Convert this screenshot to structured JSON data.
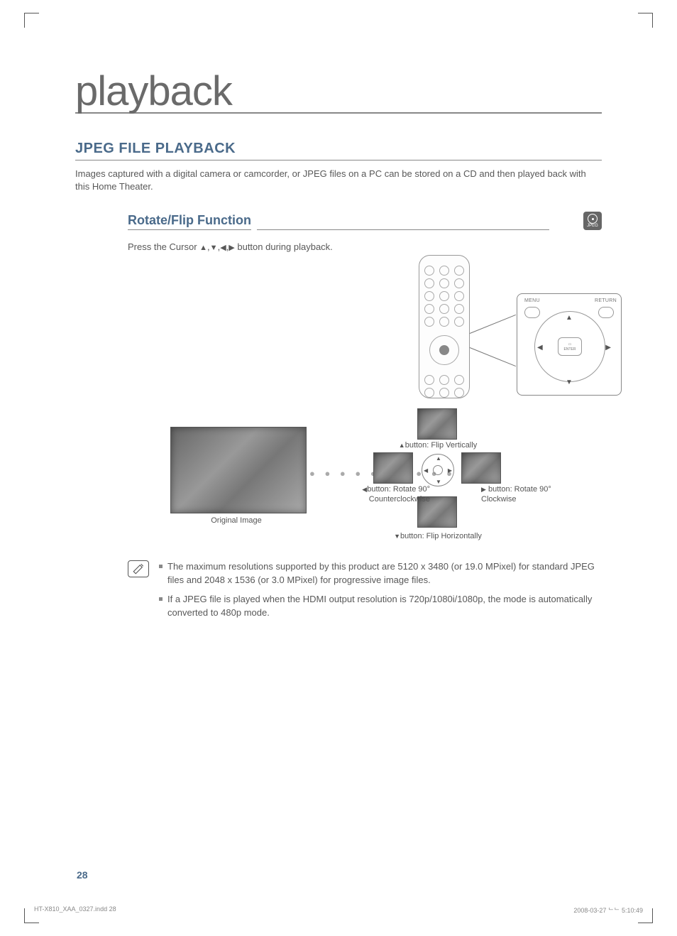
{
  "chapter_title": "playback",
  "section_title": "JPEG FILE PLAYBACK",
  "intro_text": "Images captured with a digital camera or camcorder, or JPEG files on a PC can be stored on a CD and then played back with this Home Theater.",
  "subsection_title": "Rotate/Flip Function",
  "badge_label": "JPEG",
  "instruction_prefix": "Press the Cursor ",
  "instruction_suffix": " button during playback.",
  "remote_close": {
    "menu": "MENU",
    "return": "RETURN",
    "enter": "ENTER"
  },
  "captions": {
    "original": "Original Image",
    "up": "button: Flip Vertically",
    "down": "button: Flip Horizontally",
    "left_l1": "button: Rotate 90°",
    "left_l2": "Counterclockwise",
    "right_l1": "button: Rotate 90°",
    "right_l2": "Clockwise"
  },
  "notes": [
    "The maximum resolutions supported by this product are 5120 x 3480 (or 19.0 MPixel) for standard JPEG files and 2048 x 1536 (or 3.0 MPixel) for progressive image files.",
    "If a JPEG file is played when the HDMI output resolution is 720p/1080i/1080p, the mode is automatically converted to 480p mode."
  ],
  "page_number": "28",
  "footer_left": "HT-X810_XAA_0327.indd   28",
  "footer_right": "2008-03-27   ᄂᄂ 5:10:49"
}
